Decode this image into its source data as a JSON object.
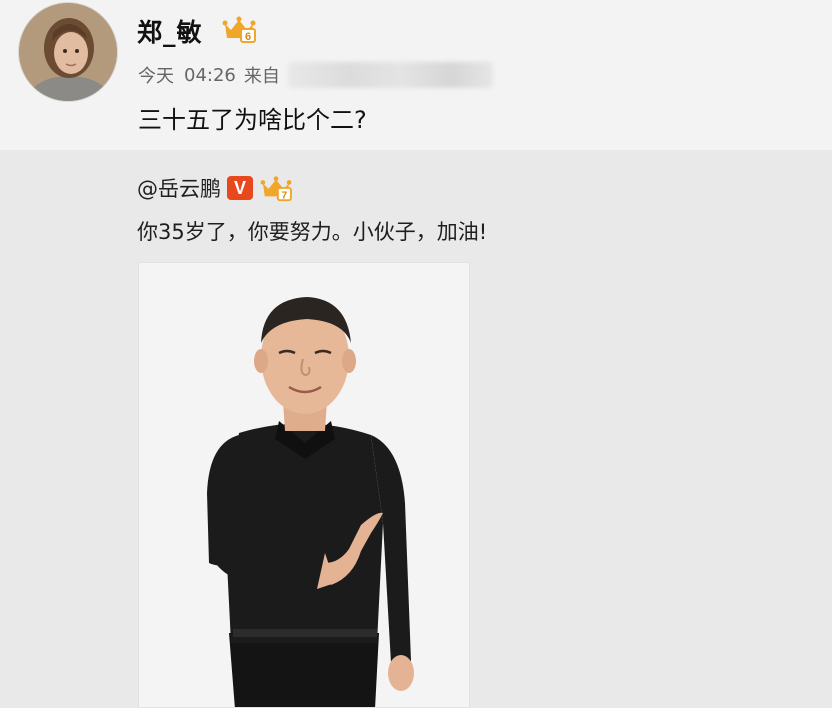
{
  "post": {
    "username": "郑_敏",
    "level_badge_icon": "crown-level-badge-icon",
    "time_label": "今天",
    "time": "04:26",
    "from_label": "来自",
    "text": "三十五了为啥比个二?"
  },
  "repost": {
    "mention": "@岳云鹏",
    "verified_badge": "V",
    "level_badge_icon": "crown-level-badge-icon",
    "text": "你35岁了，你要努力。小伙子，加油!"
  },
  "colors": {
    "verified": "#e8481e",
    "badge_gold": "#f0a52b"
  }
}
